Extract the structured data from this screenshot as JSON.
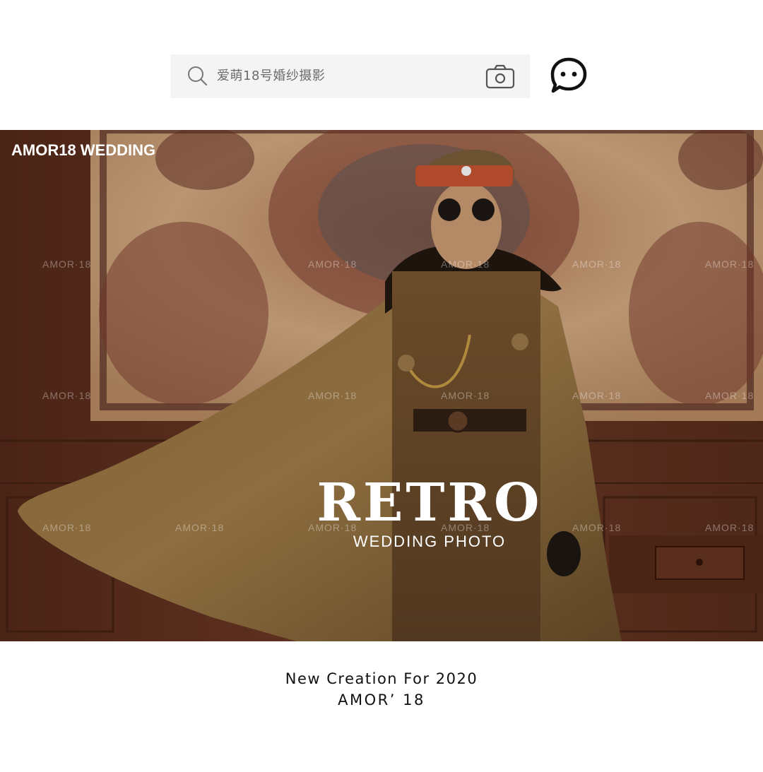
{
  "search": {
    "placeholder_text": "爱萌18号婚纱摄影",
    "search_icon": "search-icon",
    "camera_icon": "camera-icon"
  },
  "header": {
    "chat_icon": "chat-bubble-icon"
  },
  "hero": {
    "brand": "AMOR18  WEDDING",
    "watermark": "AMOR·18",
    "title": "RETRO",
    "subtitle": "WEDDING PHOTO"
  },
  "footer": {
    "line1": "New Creation For 2020",
    "line2": "AMOR’ 18"
  },
  "colors": {
    "search_bg": "#f4f4f4",
    "icon_stroke": "#222222",
    "photo_wood": "#5a2e1f",
    "photo_tan": "#8a6a3c"
  }
}
